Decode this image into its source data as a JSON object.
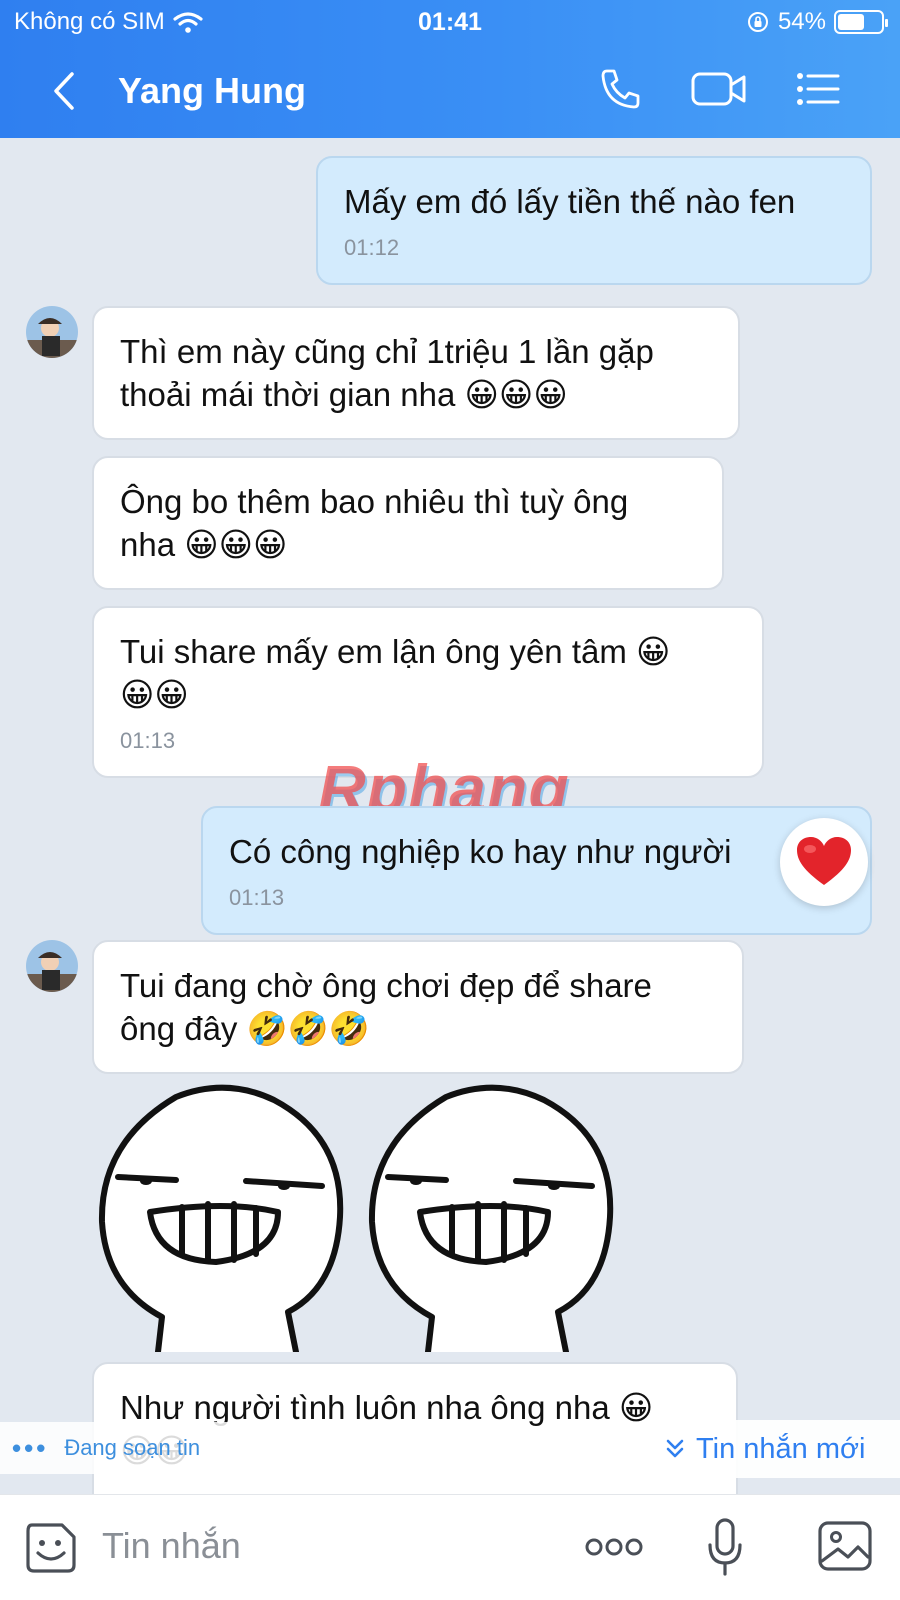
{
  "status_bar": {
    "carrier": "Không có SIM",
    "time": "01:41",
    "battery": "54%",
    "battery_level": 0.54
  },
  "header": {
    "title": "Yang Hung"
  },
  "watermark": {
    "text": "Rphang"
  },
  "messages": [
    {
      "side": "sent",
      "lines": [
        "Mấy em đó lấy tiền thế nào fen"
      ],
      "time": "01:12"
    },
    {
      "side": "recv",
      "lines": [
        "Thì em này cũng chỉ 1triệu 1 lần gặp",
        "thoải mái thời gian nha 😀😀😀"
      ],
      "time": ""
    },
    {
      "side": "recv",
      "lines": [
        "Ông bo thêm bao nhiêu thì tuỳ ông",
        "nha 😀😀😀"
      ],
      "time": ""
    },
    {
      "side": "recv",
      "lines": [
        "Tui share mấy em lận ông yên tâm 😀",
        "😀😀"
      ],
      "time": "01:13"
    },
    {
      "side": "sent",
      "lines": [
        "Có công nghiệp ko hay như người"
      ],
      "time": "01:13",
      "reaction": "❤️"
    },
    {
      "side": "recv",
      "lines": [
        "Tui đang chờ ông chơi đẹp để share",
        "ông đây 🤣🤣🤣"
      ],
      "time": ""
    },
    {
      "side": "recv",
      "lines": [
        "Như người tình luôn nha ông nha 😀",
        "😀😀"
      ],
      "time": ""
    }
  ],
  "typing_indicator": "Đang soạn tin",
  "new_message_label": "Tin nhắn mới",
  "input": {
    "placeholder": "Tin nhắn"
  }
}
